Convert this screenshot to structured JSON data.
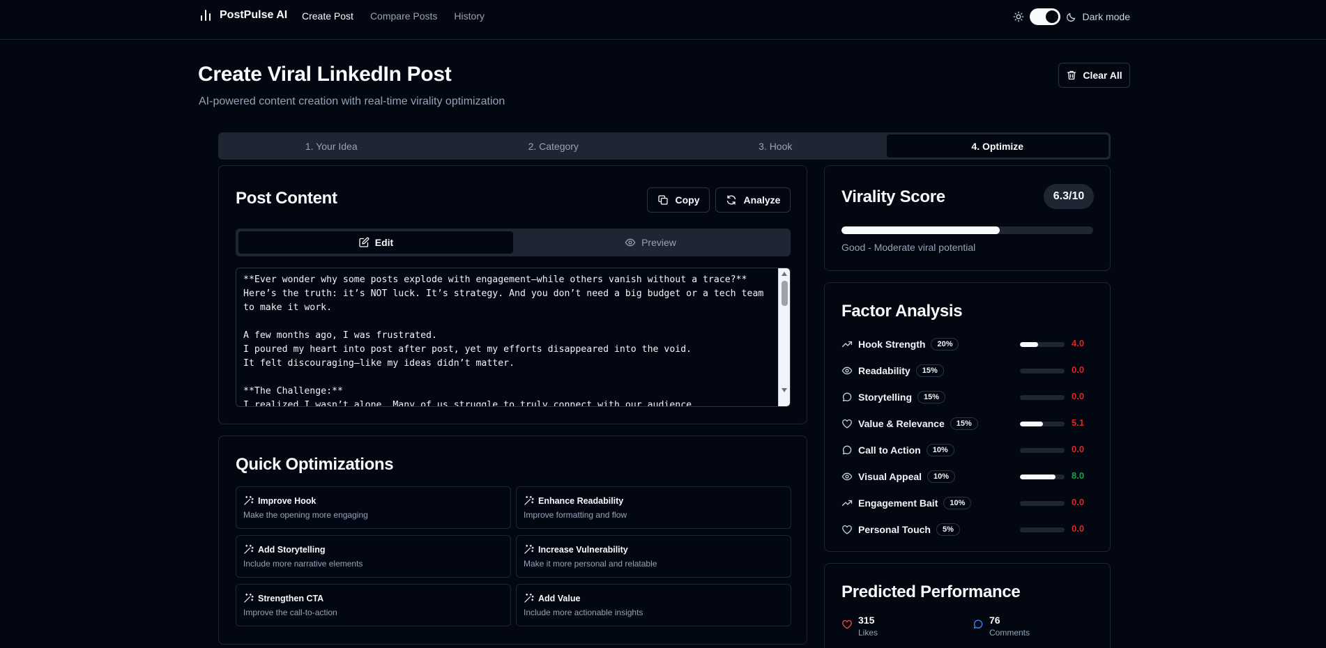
{
  "app": {
    "name": "PostPulse AI",
    "nav": [
      "Create Post",
      "Compare Posts",
      "History"
    ],
    "mode_label": "Dark mode"
  },
  "header": {
    "title": "Create Viral LinkedIn Post",
    "subtitle": "AI-powered content creation with real-time virality optimization",
    "clear_label": "Clear All"
  },
  "steps": [
    "1. Your Idea",
    "2. Category",
    "3. Hook",
    "4. Optimize"
  ],
  "post": {
    "title": "Post Content",
    "copy_label": "Copy",
    "analyze_label": "Analyze",
    "edit_label": "Edit",
    "preview_label": "Preview",
    "content": "**Ever wonder why some posts explode with engagement—while others vanish without a trace?**\nHere’s the truth: it’s NOT luck. It’s strategy. And you don’t need a big budget or a tech team to make it work.\n\nA few months ago, I was frustrated.\nI poured my heart into post after post, yet my efforts disappeared into the void.\nIt felt discouraging—like my ideas didn’t matter.\n\n**The Challenge:**\nI realized I wasn’t alone. Many of us struggle to truly connect with our audience."
  },
  "quick": {
    "title": "Quick Optimizations",
    "items": [
      {
        "title": "Improve Hook",
        "desc": "Make the opening more engaging"
      },
      {
        "title": "Enhance Readability",
        "desc": "Improve formatting and flow"
      },
      {
        "title": "Add Storytelling",
        "desc": "Include more narrative elements"
      },
      {
        "title": "Increase Vulnerability",
        "desc": "Make it more personal and relatable"
      },
      {
        "title": "Strengthen CTA",
        "desc": "Improve the call-to-action"
      },
      {
        "title": "Add Value",
        "desc": "Include more actionable insights"
      }
    ]
  },
  "virality": {
    "title": "Virality Score",
    "score_label": "6.3/10",
    "score": 6.3,
    "max": 10,
    "status": "Good - Moderate viral potential"
  },
  "factors": {
    "title": "Factor Analysis",
    "items": [
      {
        "name": "Hook Strength",
        "weight": "20%",
        "value": "4.0",
        "score": 4.0,
        "icon": "trending-up-icon",
        "color": "red"
      },
      {
        "name": "Readability",
        "weight": "15%",
        "value": "0.0",
        "score": 0.0,
        "icon": "eye-icon",
        "color": "red"
      },
      {
        "name": "Storytelling",
        "weight": "15%",
        "value": "0.0",
        "score": 0.0,
        "icon": "message-circle-icon",
        "color": "red"
      },
      {
        "name": "Value & Relevance",
        "weight": "15%",
        "value": "5.1",
        "score": 5.1,
        "icon": "heart-icon",
        "color": "red"
      },
      {
        "name": "Call to Action",
        "weight": "10%",
        "value": "0.0",
        "score": 0.0,
        "icon": "message-circle-icon",
        "color": "red"
      },
      {
        "name": "Visual Appeal",
        "weight": "10%",
        "value": "8.0",
        "score": 8.0,
        "icon": "eye-icon",
        "color": "green"
      },
      {
        "name": "Engagement Bait",
        "weight": "10%",
        "value": "0.0",
        "score": 0.0,
        "icon": "trending-up-icon",
        "color": "red"
      },
      {
        "name": "Personal Touch",
        "weight": "5%",
        "value": "0.0",
        "score": 0.0,
        "icon": "heart-icon",
        "color": "red"
      }
    ]
  },
  "predicted": {
    "title": "Predicted Performance",
    "likes": "315",
    "likes_label": "Likes",
    "comments": "76",
    "comments_label": "Comments"
  }
}
